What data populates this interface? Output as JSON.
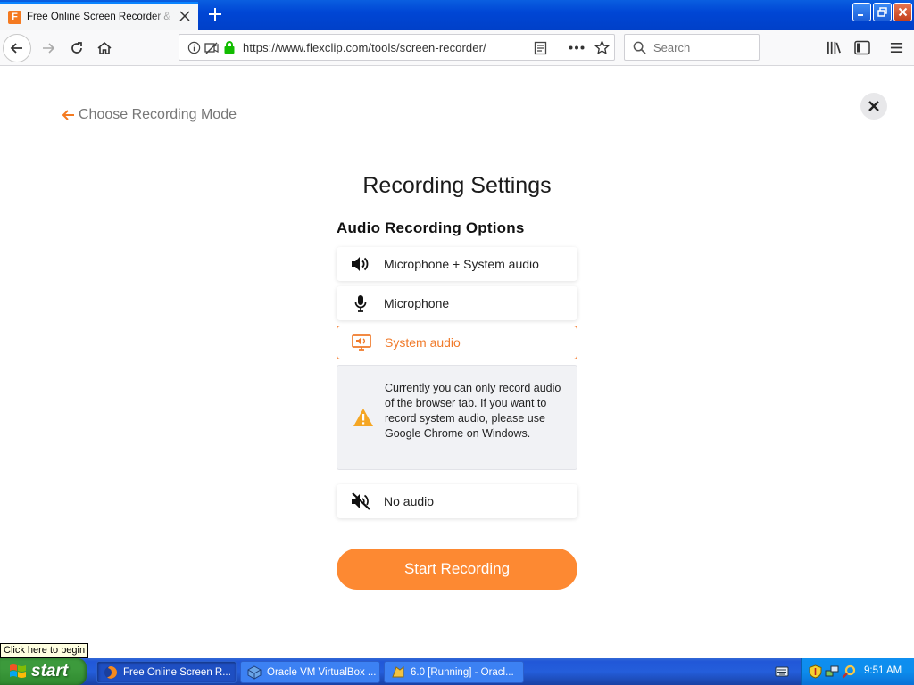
{
  "browser": {
    "tab_title": "Free Online Screen Recorder & Webcam Recorder",
    "url": "https://www.flexclip.com/tools/screen-recorder/",
    "search_placeholder": "Search"
  },
  "page": {
    "back_link": "Choose Recording Mode",
    "title": "Recording Settings",
    "section_title": "Audio Recording Options",
    "options": [
      {
        "label": "Microphone + System audio",
        "icon": "speaker-icon",
        "selected": false
      },
      {
        "label": "Microphone",
        "icon": "microphone-icon",
        "selected": false
      },
      {
        "label": "System audio",
        "icon": "system-audio-icon",
        "selected": true
      },
      {
        "label": "No audio",
        "icon": "mute-icon",
        "selected": false
      }
    ],
    "warning": "Currently you can only record audio of the browser tab. If you want to record system audio, please use Google Chrome on Windows.",
    "start_button": "Start Recording",
    "accent_color": "#fd8932"
  },
  "taskbar": {
    "tooltip": "Click here to begin",
    "start_label": "start",
    "tasks": [
      {
        "label": "Free Online Screen R...",
        "active": true
      },
      {
        "label": "Oracle VM VirtualBox ...",
        "active": false
      },
      {
        "label": "6.0 [Running] - Oracl...",
        "active": false
      }
    ],
    "clock": "9:51 AM"
  }
}
